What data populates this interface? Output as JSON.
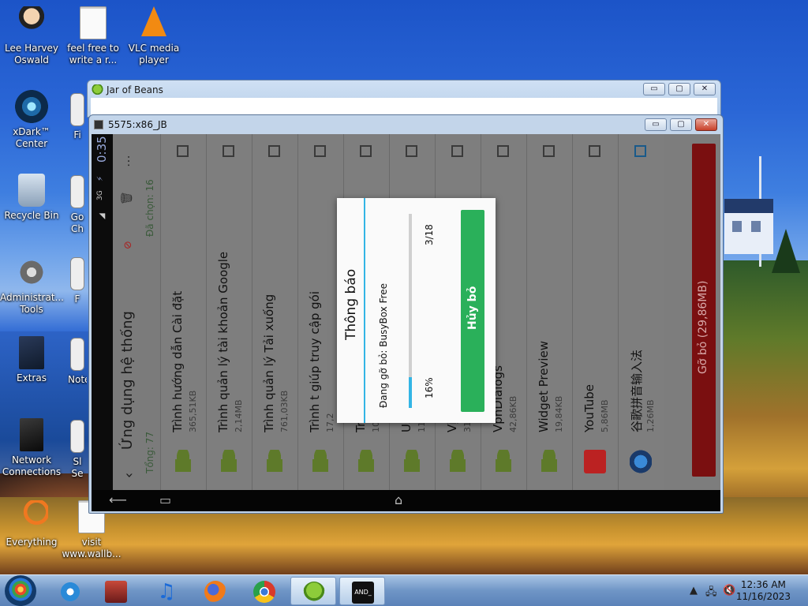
{
  "desktop": {
    "icons": [
      {
        "label": "Lee Harvey Oswald",
        "icon": "person-icon"
      },
      {
        "label": "feel free to write a r...",
        "icon": "document-icon"
      },
      {
        "label": "VLC media player",
        "icon": "vlc-icon"
      },
      {
        "label": "xDark™ Center",
        "icon": "xdark-icon"
      },
      {
        "label": "Fi",
        "icon": "partial-icon"
      },
      {
        "label": "Recycle Bin",
        "icon": "recycle-bin-icon"
      },
      {
        "label": "Go Ch",
        "icon": "partial-icon"
      },
      {
        "label": "Administrat... Tools",
        "icon": "gear-icon"
      },
      {
        "label": "F",
        "icon": "partial-icon"
      },
      {
        "label": "Extras",
        "icon": "folder-icon"
      },
      {
        "label": "Note",
        "icon": "partial-icon"
      },
      {
        "label": "Network Connections",
        "icon": "network-icon"
      },
      {
        "label": "Sl Se",
        "icon": "partial-icon"
      },
      {
        "label": "Everything",
        "icon": "everything-icon"
      },
      {
        "label": "visit www.wallb...",
        "icon": "document-icon"
      }
    ]
  },
  "jar_window": {
    "title": "Jar of Beans",
    "buttons": {
      "minimize": "▭",
      "maximize": "▢",
      "close": "✕"
    }
  },
  "emulator_window": {
    "title": "5575:x86_JB",
    "buttons": {
      "minimize": "▭",
      "maximize": "▢",
      "close": "✕"
    }
  },
  "android": {
    "statusbar": {
      "time": "0:35",
      "network": "3G"
    },
    "app": {
      "title": "Ứng dụng hệ thống",
      "total": "Tổng: 77",
      "selected": "Đã chọn: 16",
      "remove_button": "Gỡ bỏ (29,86MB)",
      "items": [
        {
          "name": "Trình hướng dẫn Cài đặt",
          "size": "365,51KB"
        },
        {
          "name": "Trình quản lý tài khoản Google",
          "size": "2,14MB"
        },
        {
          "name": "Trình quản lý Tải xuống",
          "size": "761,03KB"
        },
        {
          "name": "Trình t giúp truy cập gói",
          "size": "17,2"
        },
        {
          "name": "Trì",
          "size": "10,8"
        },
        {
          "name": "Us",
          "size": "11,2"
        },
        {
          "name": "Vị t",
          "size": "319"
        },
        {
          "name": "VpnDialogs",
          "size": "42,86KB"
        },
        {
          "name": "Widget Preview",
          "size": "19,84KB"
        },
        {
          "name": "YouTube",
          "size": "5,86MB"
        },
        {
          "name": "谷歌拼音输入法",
          "size": "1,26MB"
        }
      ]
    },
    "dialog": {
      "title": "Thông báo",
      "message": "Đang gỡ bỏ: BusyBox Free",
      "count": "3/18",
      "percent": "16%",
      "progress": 0.16,
      "cancel": "Hủy bỏ"
    }
  },
  "taskbar": {
    "apps": [
      "ie-icon",
      "store-icon",
      "itunes-icon",
      "firefox-icon",
      "chrome-icon",
      "jar-of-beans-icon",
      "android-emulator-icon"
    ],
    "clock_time": "12:36 AM",
    "clock_date": "11/16/2023"
  }
}
